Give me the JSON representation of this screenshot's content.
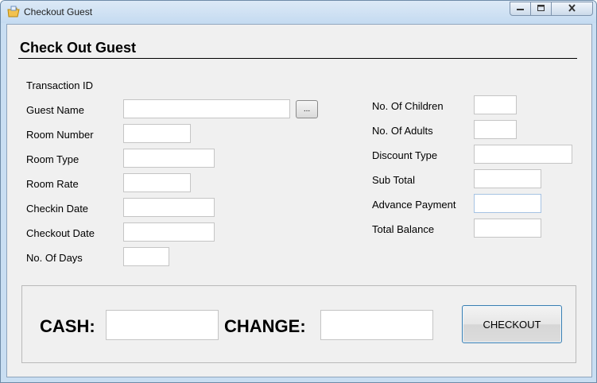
{
  "window": {
    "title": "Checkout Guest",
    "icon": "app-folder-icon",
    "controls": {
      "minimize": "minimize-icon",
      "maximize": "maximize-icon",
      "close": "close-icon"
    }
  },
  "form": {
    "title": "Check Out Guest",
    "left_fields": {
      "transaction_id": {
        "label": "Transaction ID"
      },
      "guest_name": {
        "label": "Guest Name",
        "value": "",
        "browse_label": "..."
      },
      "room_number": {
        "label": "Room Number",
        "value": ""
      },
      "room_type": {
        "label": "Room Type",
        "value": ""
      },
      "room_rate": {
        "label": "Room Rate",
        "value": ""
      },
      "checkin_date": {
        "label": "Checkin Date",
        "value": ""
      },
      "checkout_date": {
        "label": "Checkout Date",
        "value": ""
      },
      "no_of_days": {
        "label": "No. Of Days",
        "value": ""
      }
    },
    "right_fields": {
      "no_of_children": {
        "label": "No. Of Children",
        "value": ""
      },
      "no_of_adults": {
        "label": "No. Of Adults",
        "value": ""
      },
      "discount_type": {
        "label": "Discount Type",
        "value": ""
      },
      "sub_total": {
        "label": "Sub Total",
        "value": ""
      },
      "advance_payment": {
        "label": "Advance Payment",
        "value": ""
      },
      "total_balance": {
        "label": "Total Balance",
        "value": ""
      }
    },
    "payment": {
      "cash_label": "CASH:",
      "cash_value": "",
      "change_label": "CHANGE:",
      "change_value": "",
      "checkout_button": "CHECKOUT"
    }
  },
  "colors": {
    "window_frame": "#c9def2",
    "client_background": "#f0f0f0",
    "checkout_button_border": "#3c7fb1"
  }
}
